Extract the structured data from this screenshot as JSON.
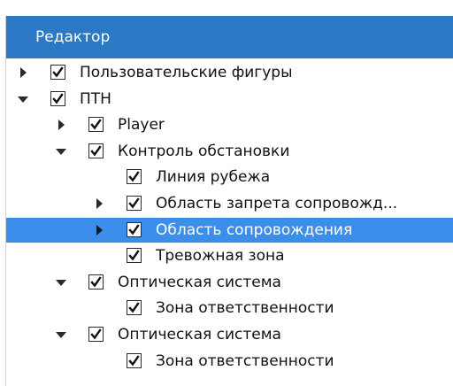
{
  "panel": {
    "title": "Редактор"
  },
  "tree": {
    "items": [
      {
        "label": "Пользовательские фигуры",
        "level": 0,
        "expander": "collapsed",
        "checked": true,
        "selected": false
      },
      {
        "label": "ПТН",
        "level": 0,
        "expander": "expanded",
        "checked": true,
        "selected": false
      },
      {
        "label": "Player",
        "level": 1,
        "expander": "collapsed",
        "checked": true,
        "selected": false
      },
      {
        "label": "Контроль обстановки",
        "level": 1,
        "expander": "expanded",
        "checked": true,
        "selected": false
      },
      {
        "label": "Линия рубежа",
        "level": 2,
        "expander": "none",
        "checked": true,
        "selected": false
      },
      {
        "label": "Область запрета сопровожд...",
        "level": 2,
        "expander": "collapsed",
        "checked": true,
        "selected": false
      },
      {
        "label": "Область сопровождения",
        "level": 2,
        "expander": "collapsed",
        "checked": true,
        "selected": true
      },
      {
        "label": "Тревожная зона",
        "level": 2,
        "expander": "none",
        "checked": true,
        "selected": false
      },
      {
        "label": "Оптическая система",
        "level": 1,
        "expander": "expanded",
        "checked": true,
        "selected": false
      },
      {
        "label": "Зона ответственности",
        "level": 2,
        "expander": "none",
        "checked": true,
        "selected": false
      },
      {
        "label": "Оптическая система",
        "level": 1,
        "expander": "expanded",
        "checked": true,
        "selected": false
      },
      {
        "label": "Зона ответственности",
        "level": 2,
        "expander": "none",
        "checked": true,
        "selected": false
      }
    ]
  },
  "colors": {
    "header_bg": "#2b78c5",
    "selection_bg": "#3b8ee9",
    "arrow": "#2a2a2a",
    "selected_arrow": "#1a1a1a"
  }
}
